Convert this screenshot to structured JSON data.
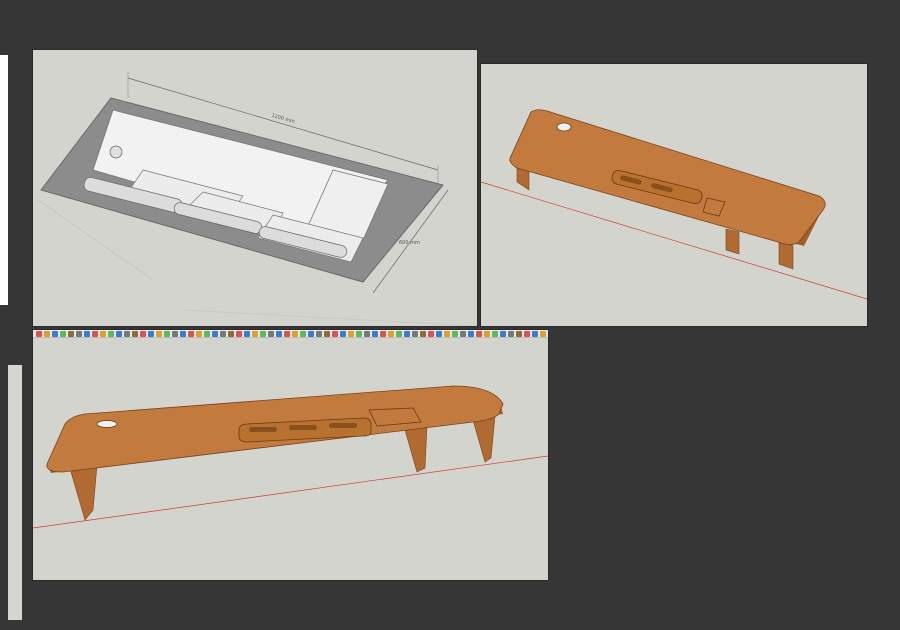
{
  "plan_view": {
    "dimension_length": "1200 mm",
    "dimension_width": "600 mm"
  },
  "colors": {
    "background": "#363636",
    "viewport": "#d4d4ce",
    "wood_top": "#c27a3e",
    "wood_edge": "#a05e2a",
    "plate": "#8c8c8c",
    "part": "#f2f2f2",
    "ground_line": "#d23a3a"
  },
  "toolbar": {
    "icon_colors": [
      "#d9534f",
      "#e0a030",
      "#3a7bd5",
      "#5cb85c",
      "#8a6d3b",
      "#777777",
      "#3a7bd5",
      "#d9534f",
      "#e0a030",
      "#5cb85c",
      "#3a7bd5",
      "#777777",
      "#8a6d3b",
      "#d9534f",
      "#3a7bd5",
      "#e0a030",
      "#5cb85c",
      "#777777",
      "#3a7bd5",
      "#d9534f",
      "#e0a030",
      "#5cb85c",
      "#3a7bd5",
      "#777777",
      "#8a6d3b",
      "#d9534f",
      "#3a7bd5",
      "#e0a030",
      "#5cb85c",
      "#777777",
      "#3a7bd5",
      "#d9534f",
      "#e0a030",
      "#5cb85c",
      "#3a7bd5",
      "#777777",
      "#8a6d3b",
      "#d9534f",
      "#3a7bd5",
      "#e0a030",
      "#5cb85c",
      "#777777",
      "#3a7bd5",
      "#d9534f",
      "#e0a030",
      "#5cb85c",
      "#3a7bd5",
      "#777777",
      "#8a6d3b",
      "#d9534f",
      "#3a7bd5",
      "#e0a030",
      "#5cb85c",
      "#777777",
      "#3a7bd5",
      "#d9534f",
      "#e0a030",
      "#5cb85c",
      "#3a7bd5",
      "#777777",
      "#8a6d3b",
      "#d9534f",
      "#3a7bd5",
      "#e0a030"
    ]
  }
}
